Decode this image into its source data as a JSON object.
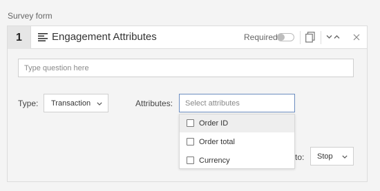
{
  "page": {
    "label": "Survey form"
  },
  "question": {
    "number": "1",
    "title": "Engagement Attributes",
    "required_label": "Required",
    "required": false,
    "question_placeholder": "Type question here",
    "question_value": ""
  },
  "type": {
    "label": "Type:",
    "selected": "Transaction"
  },
  "attributes": {
    "label": "Attributes:",
    "placeholder": "Select attributes",
    "options": [
      {
        "label": "Order ID",
        "checked": false,
        "hovered": true
      },
      {
        "label": "Order total",
        "checked": false,
        "hovered": false
      },
      {
        "label": "Currency",
        "checked": false,
        "hovered": false
      }
    ]
  },
  "end_action": {
    "label_visible": "to:",
    "selected": "Stop"
  },
  "icons": {
    "question_type": "text-lines-icon",
    "copy": "copy-icon",
    "move_down": "chevron-down-icon",
    "move_up": "chevron-up-icon",
    "close": "close-icon",
    "dropdown": "chevron-down-icon"
  },
  "colors": {
    "background": "#f4f4f4",
    "focus_border": "#6a8cbf",
    "hover_row": "#eeeeee"
  }
}
